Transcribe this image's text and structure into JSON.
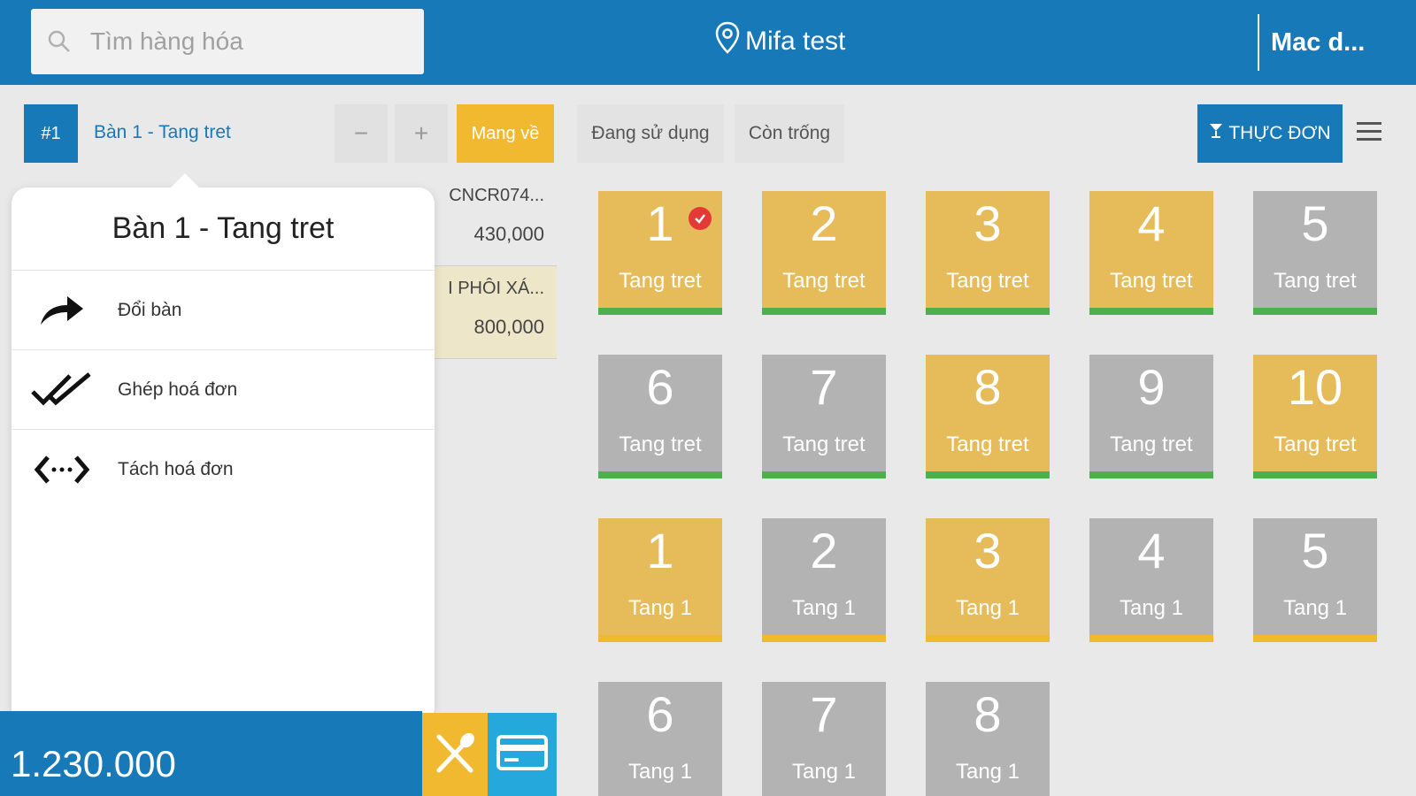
{
  "header": {
    "search_placeholder": "Tìm hàng hóa",
    "store_name": "Mifa test",
    "user_name": "Mac d..."
  },
  "toolbar": {
    "order_number": "#1",
    "order_title": "Bàn 1 - Tang tret",
    "minus_label": "−",
    "plus_label": "+",
    "takeaway_label": "Mang về",
    "filters": [
      "Đang sử dụng",
      "Còn trống"
    ],
    "menu_label": "THỰC ĐƠN"
  },
  "order_items": [
    {
      "name": "CNCR074...",
      "price": "430,000"
    },
    {
      "name": "I PHÔI XÁ...",
      "price": "800,000"
    }
  ],
  "popover": {
    "title": "Bàn 1 - Tang tret",
    "items": [
      {
        "label": "Đổi bàn",
        "icon": "share-arrow-icon"
      },
      {
        "label": "Ghép hoá đơn",
        "icon": "double-check-icon"
      },
      {
        "label": "Tách hoá đơn",
        "icon": "split-arrows-icon"
      }
    ]
  },
  "footer": {
    "total": "1.230.000"
  },
  "colors": {
    "primary": "#1779b8",
    "occupied": "#e6bc5a",
    "empty": "#b3b3b3",
    "bar_green": "#4caf50",
    "bar_orange": "#f0b92f",
    "badge_red": "#e53935"
  },
  "tables": [
    {
      "num": "1",
      "area": "Tang tret",
      "status": "occupied",
      "bar": "green",
      "checked": true
    },
    {
      "num": "2",
      "area": "Tang tret",
      "status": "occupied",
      "bar": "green"
    },
    {
      "num": "3",
      "area": "Tang tret",
      "status": "occupied",
      "bar": "green"
    },
    {
      "num": "4",
      "area": "Tang tret",
      "status": "occupied",
      "bar": "green"
    },
    {
      "num": "5",
      "area": "Tang tret",
      "status": "empty",
      "bar": "green"
    },
    {
      "num": "6",
      "area": "Tang tret",
      "status": "empty",
      "bar": "green"
    },
    {
      "num": "7",
      "area": "Tang tret",
      "status": "empty",
      "bar": "green"
    },
    {
      "num": "8",
      "area": "Tang tret",
      "status": "occupied",
      "bar": "green"
    },
    {
      "num": "9",
      "area": "Tang tret",
      "status": "empty",
      "bar": "green"
    },
    {
      "num": "10",
      "area": "Tang tret",
      "status": "occupied",
      "bar": "green"
    },
    {
      "num": "1",
      "area": "Tang 1",
      "status": "occupied",
      "bar": "orange"
    },
    {
      "num": "2",
      "area": "Tang 1",
      "status": "empty",
      "bar": "orange"
    },
    {
      "num": "3",
      "area": "Tang 1",
      "status": "occupied",
      "bar": "orange"
    },
    {
      "num": "4",
      "area": "Tang 1",
      "status": "empty",
      "bar": "orange"
    },
    {
      "num": "5",
      "area": "Tang 1",
      "status": "empty",
      "bar": "orange"
    },
    {
      "num": "6",
      "area": "Tang 1",
      "status": "empty",
      "bar": "orange"
    },
    {
      "num": "7",
      "area": "Tang 1",
      "status": "empty",
      "bar": "orange"
    },
    {
      "num": "8",
      "area": "Tang 1",
      "status": "empty",
      "bar": "orange"
    }
  ]
}
